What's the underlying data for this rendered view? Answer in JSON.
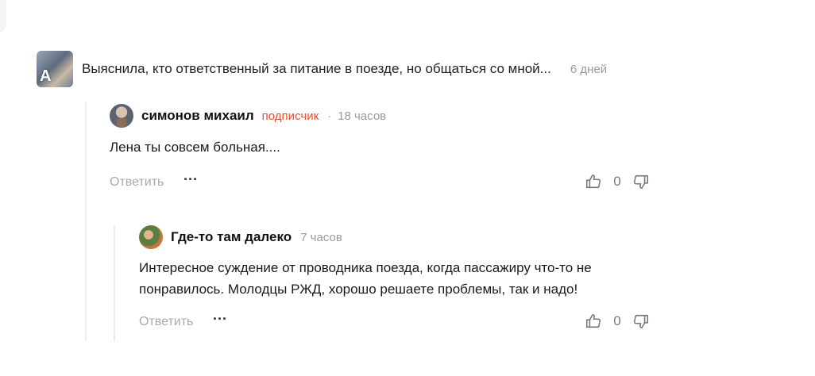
{
  "article": {
    "thumb_letter": "A",
    "title": "Выяснила, кто ответственный за питание в поезде, но общаться со мной...",
    "time": "6 дней"
  },
  "comments": [
    {
      "author": "симонов михаил",
      "badge": "подписчик",
      "separator": "·",
      "time": "18 часов",
      "text": "Лена ты совсем больная....",
      "reply_label": "Ответить",
      "more_label": "···",
      "like_count": "0"
    },
    {
      "author": "Где-то там далеко",
      "time": "7 часов",
      "text_line1": "Интересное суждение от проводника поезда, когда пассажиру что-то не",
      "text_line2": "понравилось. Молодцы РЖД, хорошо решаете проблемы, так и надо!",
      "reply_label": "Ответить",
      "more_label": "···",
      "like_count": "0"
    }
  ],
  "icons": {
    "like": "thumbs-up-icon",
    "dislike": "thumbs-down-icon",
    "more": "more-dots-icon"
  },
  "colors": {
    "badge": "#e5502e",
    "muted": "#9a9a9a",
    "thread_line": "#ececec"
  }
}
